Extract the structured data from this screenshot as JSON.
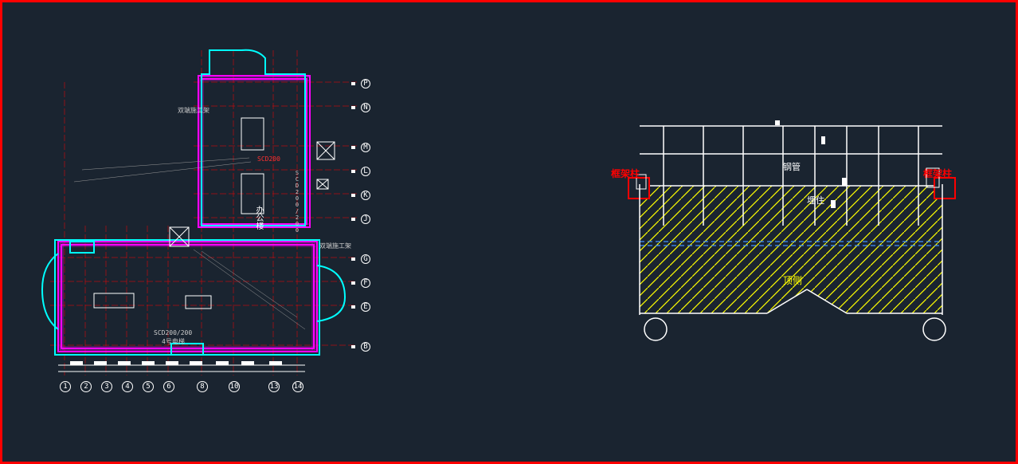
{
  "left_drawing": {
    "building_name": "办公楼",
    "grid_numbers": [
      "1",
      "2",
      "3",
      "4",
      "5",
      "6",
      "8",
      "10",
      "13",
      "14"
    ],
    "grid_letters": [
      "P",
      "N",
      "M",
      "L",
      "K",
      "J",
      "G",
      "F",
      "E",
      "B"
    ],
    "equipment_labels": [
      "SCD200/200",
      "SCD200/200"
    ],
    "annotations": [
      "双端施工架",
      "双端施工架",
      "4号电梯"
    ]
  },
  "right_drawing": {
    "labels": {
      "left_column": "框架柱",
      "right_column": "框架柱",
      "pipe": "钢管",
      "embed": "埋住",
      "top": "顶侧"
    }
  }
}
